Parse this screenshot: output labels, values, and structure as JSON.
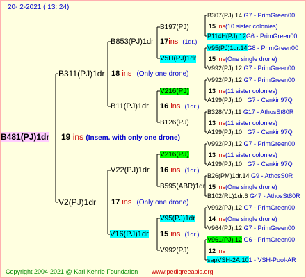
{
  "date": "20-  2-2021 ( 13: 24)",
  "root": {
    "label": "B481(PJ)1dr",
    "num": "19",
    "ins": "ins",
    "note": "(Insem. with only one drone)"
  },
  "gen1": [
    {
      "label": "B311(PJ)1dr",
      "num": "18",
      "ins": "ins",
      "note": "(Only one drone)"
    },
    {
      "label": "V2(PJ)1dr",
      "num": "17",
      "ins": "ins",
      "note": "(Only one drone)"
    }
  ],
  "gen2": [
    {
      "label": "B853(PJ)1dr",
      "num": "17",
      "ins": "ins",
      "note": "(1dr.)"
    },
    {
      "label": "B11(PJ)1dr",
      "num": "16",
      "ins": "ins",
      "note": "(1dr.)"
    },
    {
      "label": "V22(PJ)1dr",
      "num": "16",
      "ins": "ins",
      "note": "(1dr.)"
    },
    {
      "label": "V16(PJ)1dr",
      "num": "15",
      "ins": "ins",
      "note": "(1dr.)"
    }
  ],
  "gen3": [
    {
      "label": "B197(PJ)"
    },
    {
      "label": "V5H(PJ)1dr"
    },
    {
      "label": "V216(PJ)"
    },
    {
      "label": "B126(PJ)"
    },
    {
      "label": "V216(PJ)"
    },
    {
      "label": "B595(ABR)1dr"
    },
    {
      "label": "V95(PJ)1dr"
    },
    {
      "label": "V992(PJ)"
    }
  ],
  "gen3_info": [
    {
      "num": "15",
      "ins": "ins",
      "note": "(10 sister colonies)"
    },
    {
      "num": "15",
      "ins": "ins",
      "note": "(One single drone)"
    },
    {
      "num": "13",
      "ins": "ins",
      "note": "(11 sister colonies)"
    },
    {
      "num": "13",
      "ins": "ins",
      "note": "(11 sister colonies)"
    },
    {
      "num": "13",
      "ins": "ins",
      "note": "(11 sister colonies)"
    },
    {
      "num": "15",
      "ins": "ins",
      "note": "(One single drone)"
    },
    {
      "num": "14",
      "ins": "ins",
      "note": "(One single drone)"
    },
    {
      "num": "12",
      "ins": "ins",
      "note": ""
    }
  ],
  "gen4": [
    {
      "name": "B307(PJ).14",
      "src": "G7 - PrimGreen00"
    },
    {
      "name": "P114H(PJ).12",
      "src": "G6 - PrimGreen00"
    },
    {
      "name": "V95(PJ)1dr.14",
      "src": "G8 - PrimGreen00"
    },
    {
      "name": "V992(PJ).12",
      "src": "G7 - PrimGreen00"
    },
    {
      "name": "V992(PJ).12",
      "src": "G7 - PrimGreen00"
    },
    {
      "name": "A199(PJ).10",
      "src": "G7 - Cankiri97Q"
    },
    {
      "name": "B328(VJ).11",
      "src": "G17 - AthosSt80R"
    },
    {
      "name": "A199(PJ).10",
      "src": "G7 - Cankiri97Q"
    },
    {
      "name": "V992(PJ).12",
      "src": "G7 - PrimGreen00"
    },
    {
      "name": "A199(PJ).10",
      "src": "G7 - Cankiri97Q"
    },
    {
      "name": "B26(PM)1dr.14",
      "src": "G9 - AthosS0R"
    },
    {
      "name": "B102(RL)1dr.6",
      "src": "G47 - AthosSt80R"
    },
    {
      "name": "V992(PJ).12",
      "src": "G7 - PrimGreen00"
    },
    {
      "name": "V964(PJ).12",
      "src": "G7 - PrimGreen00"
    },
    {
      "name": "V961(PJ).12",
      "src": "G6 - PrimGreen00"
    },
    {
      "name": "sapVSH-2A.10",
      "src": "1 - VSH-Pool-AR"
    }
  ],
  "footer": {
    "copyright": "Copyright 2004-2021 @ Karl Kehrle Foundation",
    "url": "www.pedigreeapis.org"
  }
}
